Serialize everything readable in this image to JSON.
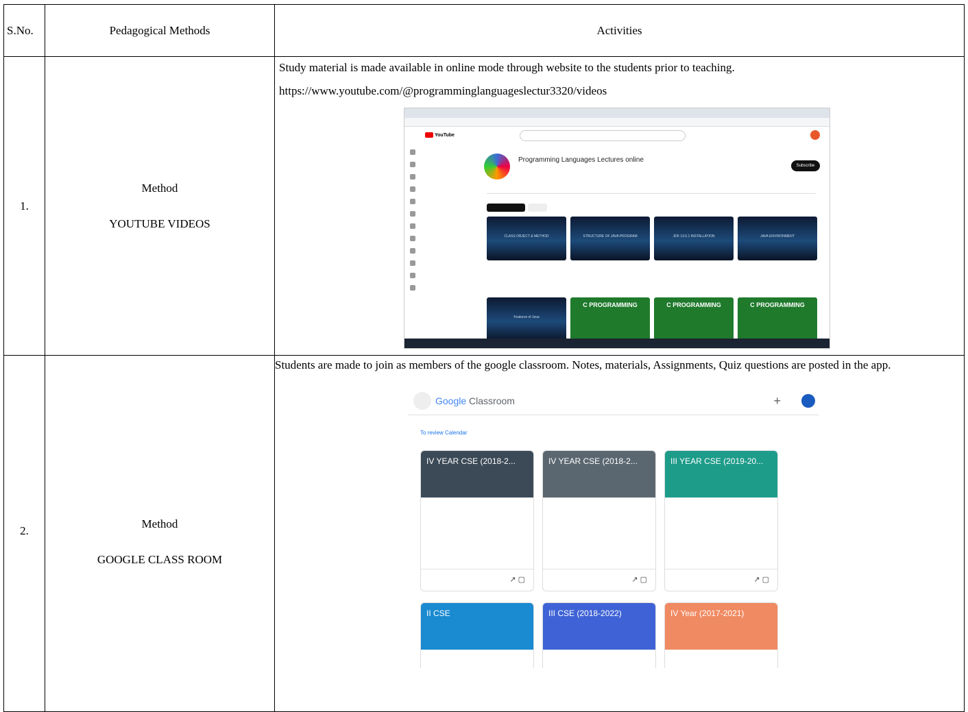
{
  "table": {
    "headers": {
      "sno": "S.No.",
      "methods": "Pedagogical Methods",
      "activities": "Activities"
    },
    "rows": [
      {
        "sno": "1.",
        "method_line1": "Method",
        "method_line2": "YOUTUBE VIDEOS",
        "description": "Study material is made available in online mode through website to the students prior to teaching.",
        "link": "https://www.youtube.com/@programminglanguageslectur3320/videos"
      },
      {
        "sno": "2.",
        "method_line1": "Method",
        "method_line2": "GOOGLE CLASS ROOM",
        "description": "Students are made to join as members of the google classroom. Notes, materials, Assignments, Quiz questions are posted in the app."
      }
    ]
  },
  "youtube_screenshot": {
    "logo": "YouTube",
    "channel_name": "Programming Languages Lectures online",
    "subscribe": "Subscribe",
    "thumbnails": [
      "CLASS OBJECT & METHOD",
      "STRUCTURE OF JAVA PROGRAM",
      "JDK 13.0.1 INSTALLATION",
      "JAVA ENVIRONMENT",
      "Features of Java",
      "C PROGRAMMING",
      "C PROGRAMMING",
      "C PROGRAMMING"
    ]
  },
  "classroom_screenshot": {
    "brand_google": "Google",
    "brand_product": " Classroom",
    "links": "To review   Calendar",
    "cards": [
      {
        "title": "IV YEAR CSE (2018-2...",
        "color": "#3c4a57"
      },
      {
        "title": "IV YEAR CSE (2018-2...",
        "color": "#5b6770"
      },
      {
        "title": "III YEAR CSE (2019-20...",
        "color": "#1e9c8a"
      },
      {
        "title": "II CSE",
        "color": "#1a8ad1"
      },
      {
        "title": "III CSE (2018-2022)",
        "color": "#3f63d6"
      },
      {
        "title": "IV Year (2017-2021)",
        "color": "#f08a62"
      }
    ]
  }
}
